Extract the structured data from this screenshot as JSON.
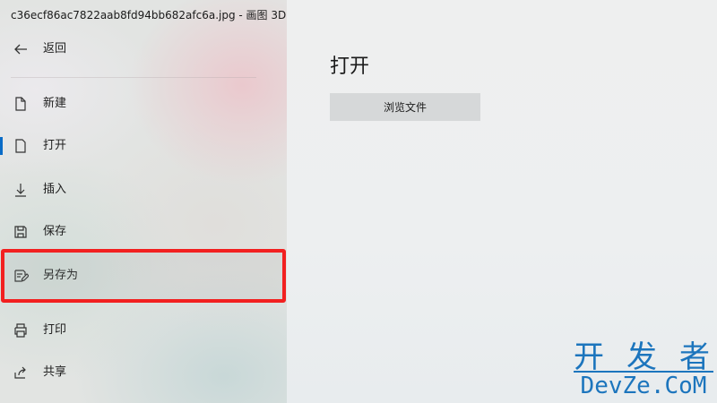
{
  "window": {
    "title": "c36ecf86ac7822aab8fd94bb682afc6a.jpg - 画图 3D"
  },
  "sidebar": {
    "back_label": "返回",
    "items": [
      {
        "label": "新建",
        "icon": "new-file-icon"
      },
      {
        "label": "打开",
        "icon": "open-file-icon",
        "active": true
      },
      {
        "label": "插入",
        "icon": "insert-icon"
      },
      {
        "label": "保存",
        "icon": "save-icon"
      },
      {
        "label": "另存为",
        "icon": "save-as-icon",
        "highlighted": true
      },
      {
        "label": "打印",
        "icon": "print-icon"
      },
      {
        "label": "共享",
        "icon": "share-icon"
      }
    ]
  },
  "main": {
    "heading": "打开",
    "browse_button": "浏览文件"
  },
  "watermark": {
    "top_text": "开发者",
    "bottom_text": "DevZe.CoM"
  },
  "colors": {
    "accent": "#0a6cc7",
    "highlight_border": "#f22020",
    "watermark": "#1c75bd",
    "button_bg": "#d6d8d9"
  }
}
